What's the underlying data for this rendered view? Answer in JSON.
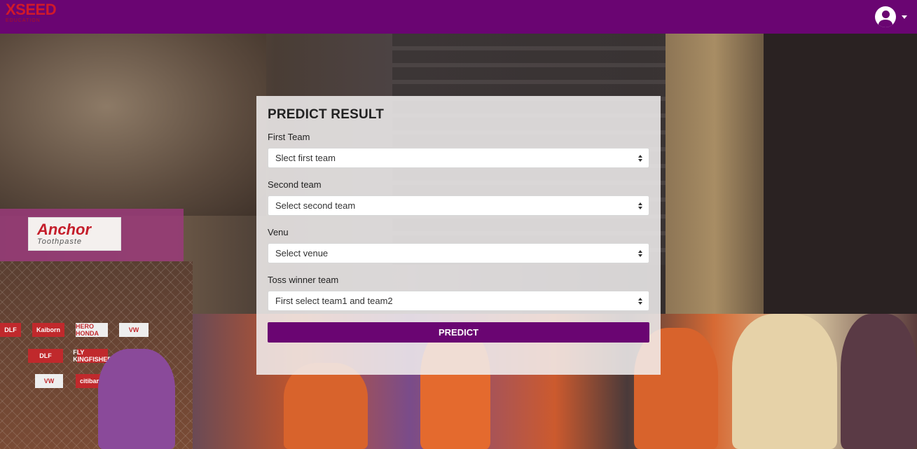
{
  "navbar": {
    "logo_text": "XSEED",
    "logo_subtext": "EDUCATION",
    "user_icon": "user-circle-icon",
    "dropdown_icon": "caret-down-icon",
    "background_color": "#6a0572"
  },
  "background_scene": {
    "anchor_brand": "Anchor",
    "anchor_tagline": "Toothpaste",
    "ads": [
      "DLF",
      "Kaiborn",
      "HERO HONDA",
      "VW",
      "FLY KINGFISHER",
      "DLF",
      "VW",
      "citibank"
    ]
  },
  "form": {
    "title": "PREDICT RESULT",
    "first_team": {
      "label": "First Team",
      "selected": "Slect first team"
    },
    "second_team": {
      "label": "Second team",
      "selected": "Select second team"
    },
    "venue": {
      "label": "Venu",
      "selected": "Select venue"
    },
    "toss_winner": {
      "label": "Toss winner team",
      "selected": "First select team1 and team2"
    },
    "predict_label": "PREDICT",
    "button_color": "#6a0572"
  }
}
